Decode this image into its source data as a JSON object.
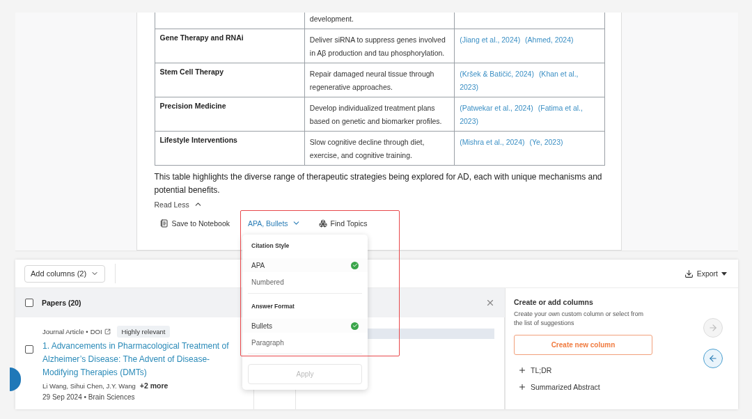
{
  "table": {
    "rows": [
      {
        "strategy": "",
        "mechanism": "development.",
        "references": []
      },
      {
        "strategy": "Gene Therapy and RNAi",
        "mechanism": "Deliver siRNA to suppress genes involved in Aβ production and tau phosphorylation.",
        "references": [
          "(Jiang et al., 2024)",
          "(Ahmed, 2024)"
        ]
      },
      {
        "strategy": "Stem Cell Therapy",
        "mechanism": "Repair damaged neural tissue through regenerative approaches.",
        "references": [
          "(Kršek & Batičić, 2024)",
          "(Khan et al., 2023)"
        ]
      },
      {
        "strategy": "Precision Medicine",
        "mechanism": "Develop individualized treatment plans based on genetic and biomarker profiles.",
        "references": [
          "(Patwekar et al., 2024)",
          "(Fatima et al., 2023)"
        ]
      },
      {
        "strategy": "Lifestyle Interventions",
        "mechanism": "Slow cognitive decline through diet, exercise, and cognitive training.",
        "references": [
          "(Mishra et al., 2024)",
          "(Ye, 2023)"
        ]
      }
    ]
  },
  "summary": "This table highlights the diverse range of therapeutic strategies being explored for AD, each with unique mechanisms and potential benefits.",
  "read_less": "Read Less",
  "actions": {
    "save": "Save to Notebook",
    "format": "APA, Bullets",
    "topics": "Find Topics"
  },
  "format_menu": {
    "groups": [
      {
        "heading": "Citation Style",
        "options": [
          {
            "label": "APA",
            "selected": true
          },
          {
            "label": "Numbered",
            "selected": false
          }
        ]
      },
      {
        "heading": "Answer Format",
        "options": [
          {
            "label": "Bullets",
            "selected": true
          },
          {
            "label": "Paragraph",
            "selected": false
          }
        ]
      }
    ],
    "apply": {
      "label": "Apply",
      "disabled": true
    }
  },
  "toolbar": {
    "add_columns": "Add columns (2)",
    "export": "Export"
  },
  "papers": {
    "header": "Papers (20)",
    "checked": false,
    "rows": [
      {
        "type": "Journal Article •",
        "doi": "DOI",
        "badge": "Highly relevant",
        "title": "1. Advancements in Pharmacological Treatment of Alzheimer’s Disease: The Advent of Disease-Modifying Therapies (DMTs)",
        "authors": "Li Wang, Sihui Chen, J.Y. Wang",
        "more": "+2 more",
        "meta": "29 Sep 2024 • Brain Sciences",
        "checked": false
      }
    ]
  },
  "columns_panel": {
    "title": "Create or add columns",
    "description": "Create your own custom column or select from the list of suggestions",
    "create": "Create new column",
    "suggestions": [
      "TL;DR",
      "Summarized Abstract"
    ]
  }
}
